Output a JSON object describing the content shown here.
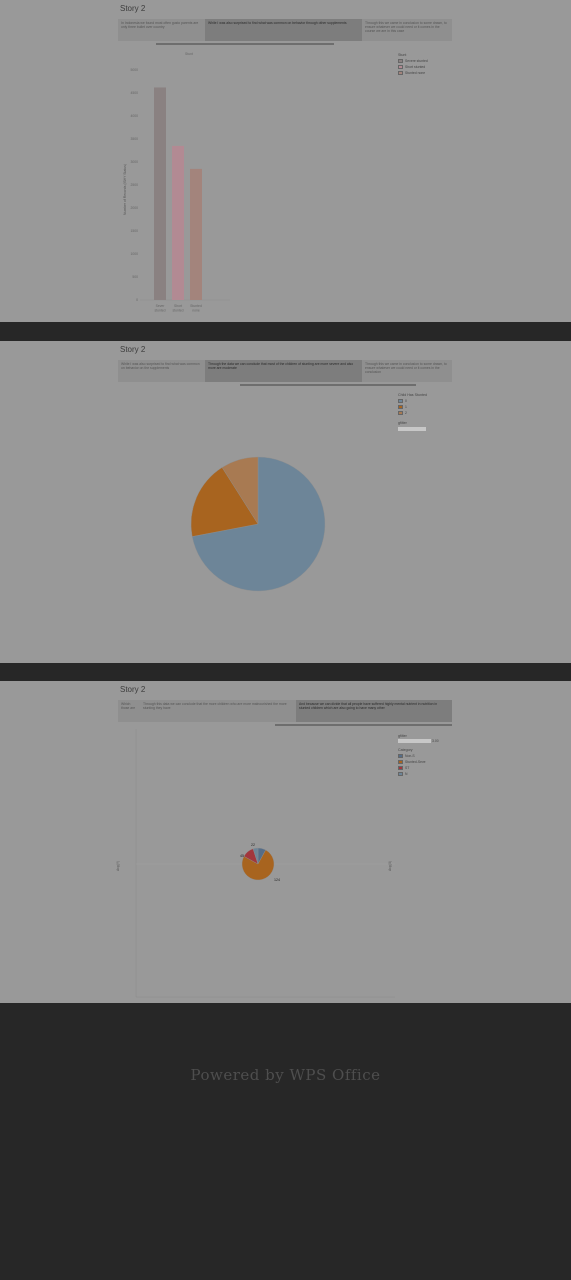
{
  "footer": {
    "text": "Powered by WPS Office"
  },
  "page1": {
    "story_title": "Story 2",
    "captions": [
      "In Indonesia we found most often gusto parents are only three bullet over country",
      "While I was also surprised to find what was common on behavior through other supplements",
      "Through this we came in conclusion to some drawn, to ensure whatever we could need or it comes in the course we are in this case"
    ],
    "chart_data": {
      "type": "bar",
      "title": "Stunt",
      "ylabel": "Number of Records (ISHY Status)",
      "ylim": [
        0,
        5000
      ],
      "yticks": [
        "0",
        "500",
        "1000",
        "1500",
        "2000",
        "2500",
        "3000",
        "3500",
        "4000",
        "4500",
        "5000"
      ],
      "categories": [
        "Sever stunted",
        "Short stunted",
        "Stunted none"
      ],
      "values": [
        4620,
        3350,
        2850
      ],
      "colors": [
        "#8a8181",
        "#b28a93",
        "#a3847c"
      ],
      "legend": {
        "title": "Stunt",
        "items": [
          "Severe stunted",
          "Short stunted",
          "Stunted none"
        ]
      }
    }
  },
  "page2": {
    "story_title": "Story 2",
    "captions": [
      "While I was also surprised to find what was common on behavior on the supplements",
      "Through the data we can conclude that most of the children of stunting are more severe and also more are moderate",
      "Through this we came in conclusion to some drawn, to ensure whatever we could need or it comes in the conclusion"
    ],
    "chart_data": {
      "type": "pie",
      "categories": [
        "0",
        "1",
        "2"
      ],
      "values": [
        72,
        19,
        9
      ],
      "colors": [
        "#6d8598",
        "#a8641f",
        "#a87a52"
      ],
      "legend": {
        "title": "Child Has Stunted",
        "items": [
          "0",
          "1",
          "2"
        ],
        "filter_title": "gfilter"
      }
    }
  },
  "page3": {
    "story_title": "Story 2",
    "captions": [
      "Which those are",
      "Through this data we can conclude that the more children who are more malnourished the more stunting they have",
      "And because we can divide that all people have suffered highly mental nutrient in nutrition in stunted children which are also going to have many other"
    ],
    "chart_data": {
      "type": "pie",
      "categories": [
        "none",
        "severe stunted",
        "stunted",
        "short"
      ],
      "values": [
        8,
        75,
        12,
        5
      ],
      "colors": [
        "#556d88",
        "#a8641f",
        "#a2363d",
        "#6d8598"
      ],
      "data_labels": [
        "22",
        "124",
        "45"
      ],
      "xlabel": "Avg(X)",
      "ylabel": "Avg(Y)",
      "legend": {
        "filter_title": "gfilter",
        "filter_value": "3.00",
        "title": "Category",
        "items": [
          "Non-S",
          "Stunted-Seve",
          "ST",
          "N"
        ]
      }
    }
  }
}
